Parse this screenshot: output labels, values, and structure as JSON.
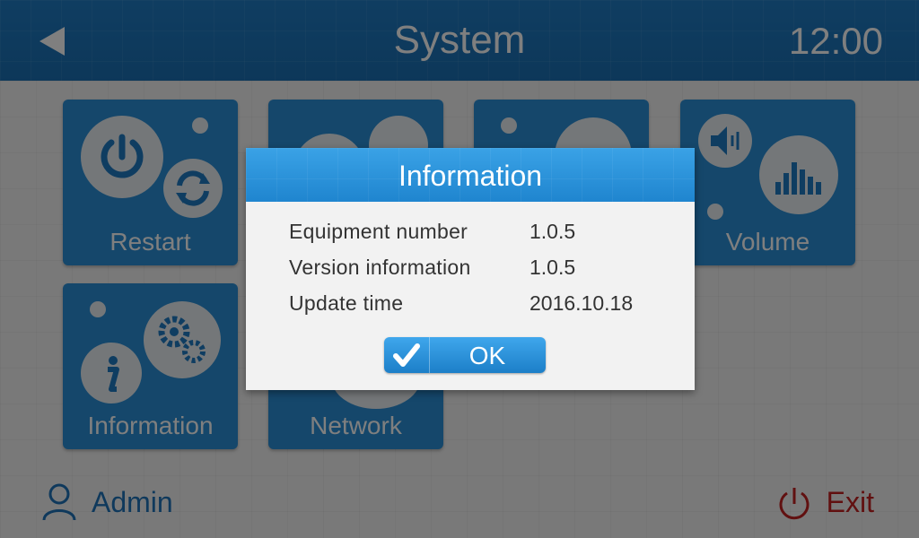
{
  "header": {
    "title": "System",
    "time": "12:00"
  },
  "tiles": [
    {
      "label": "Restart"
    },
    {
      "label": ""
    },
    {
      "label": ""
    },
    {
      "label": "Volume"
    },
    {
      "label": "Information"
    },
    {
      "label": "Network"
    }
  ],
  "footer": {
    "user_label": "Admin",
    "exit_label": "Exit"
  },
  "dialog": {
    "title": "Information",
    "rows": [
      {
        "key": "Equipment number",
        "value": "1.0.5"
      },
      {
        "key": "Version information",
        "value": "1.0.5"
      },
      {
        "key": "Update time",
        "value": "2016.10.18"
      }
    ],
    "ok_label": "OK"
  },
  "colors": {
    "accent": "#1f7bc3",
    "tile": "#2a8fd6",
    "exit": "#c32020"
  },
  "icons": [
    "back-arrow-icon",
    "power-icon",
    "refresh-icon",
    "speaker-icon",
    "equalizer-icon",
    "info-icon",
    "gears-icon",
    "user-icon",
    "checkmark-icon"
  ]
}
